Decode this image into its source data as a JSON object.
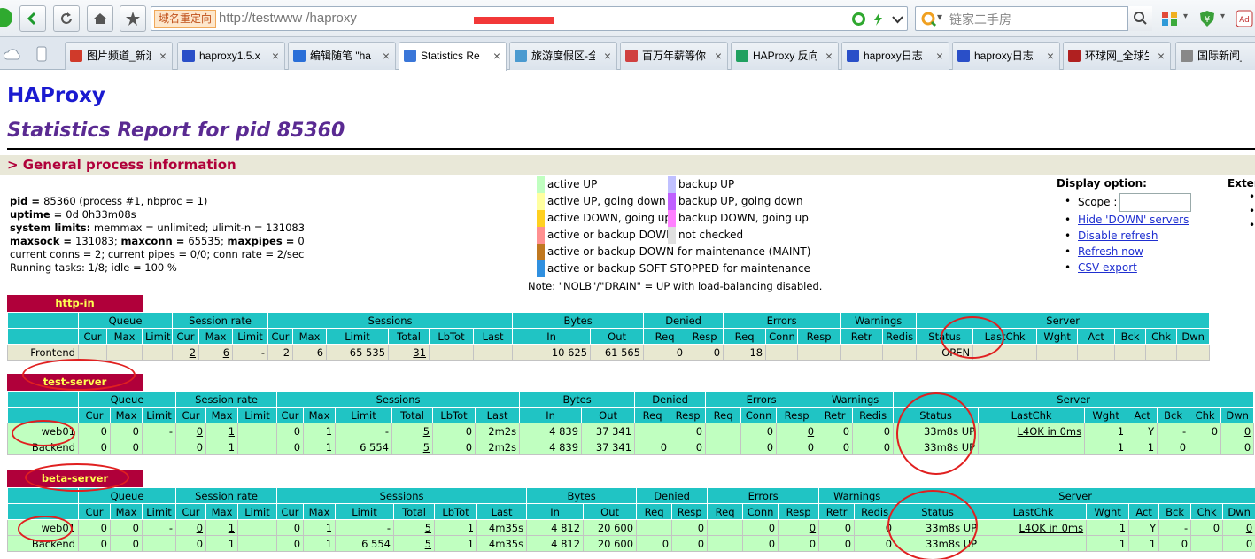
{
  "browser": {
    "redirect_label": "域名重定向",
    "url": "http://testwww                    /haproxy",
    "search_placeholder": "链家二手房"
  },
  "tabs": [
    {
      "label": "图片频道_新浪",
      "icon": "sina-icon",
      "color": "#d03a2a"
    },
    {
      "label": "haproxy1.5.x",
      "icon": "baidu-paw-icon",
      "color": "#2a4fc8"
    },
    {
      "label": "编辑随笔 \"ha",
      "icon": "blog-icon",
      "color": "#2a6fd8"
    },
    {
      "label": "Statistics Re",
      "icon": "haproxy-icon",
      "color": "#3a76d8",
      "active": true
    },
    {
      "label": "旅游度假区-全",
      "icon": "travel-icon",
      "color": "#4a9ad0"
    },
    {
      "label": "百万年薪等你",
      "icon": "job-icon",
      "color": "#d04040"
    },
    {
      "label": "HAProxy 反向",
      "icon": "csdn-icon",
      "color": "#20a060"
    },
    {
      "label": "haproxy日志",
      "icon": "baidu-paw-icon",
      "color": "#2a4fc8"
    },
    {
      "label": "haproxy日志",
      "icon": "baidu-paw-icon",
      "color": "#2a4fc8"
    },
    {
      "label": "环球网_全球生",
      "icon": "huanqiu-icon",
      "color": "#b02020"
    },
    {
      "label": "国际新闻_环",
      "icon": "page-icon",
      "color": "#888888"
    }
  ],
  "page": {
    "title": "HAProxy",
    "subtitle": "Statistics Report for pid 85360",
    "section": "> General process information",
    "info": {
      "pid_k": "pid = ",
      "pid_v": "85360 (process #1, nbproc = 1)",
      "uptime_k": "uptime = ",
      "uptime_v": "0d 0h33m08s",
      "limits_k": "system limits:",
      "limits_v": " memmax = unlimited; ulimit-n = 131083",
      "maxsock_k": "maxsock = ",
      "maxsock_v": "131083; ",
      "maxconn_k": "maxconn = ",
      "maxconn_v": "65535; ",
      "maxpipes_k": "maxpipes = ",
      "maxpipes_v": "0",
      "line5": "current conns = 2; current pipes = 0/0; conn rate = 2/sec",
      "line6": "Running tasks: 1/8; idle = 100 %"
    },
    "legend_left": [
      {
        "label": "active UP",
        "color": "#c0ffc0"
      },
      {
        "label": "active UP, going down",
        "color": "#ffffa0"
      },
      {
        "label": "active DOWN, going up",
        "color": "#ffd020"
      },
      {
        "label": "active or backup DOWN",
        "color": "#ff9090"
      },
      {
        "label": "active or backup DOWN for maintenance (MAINT)",
        "color": "#c07820"
      },
      {
        "label": "active or backup SOFT STOPPED for maintenance",
        "color": "#3090e0"
      }
    ],
    "legend_right": [
      {
        "label": "backup UP",
        "color": "#c0c0ff"
      },
      {
        "label": "backup UP, going down",
        "color": "#c060ff"
      },
      {
        "label": "backup DOWN, going up",
        "color": "#ff80ff"
      },
      {
        "label": "not checked",
        "color": "#e0e0e0"
      }
    ],
    "note": "Note: \"NOLB\"/\"DRAIN\" = UP with load-balancing disabled.",
    "display": {
      "title": "Display option:",
      "scope": "Scope :",
      "hide_down": "Hide 'DOWN' servers",
      "disable_refresh": "Disable refresh",
      "refresh_now": "Refresh now",
      "csv": "CSV export"
    },
    "external": "Exter"
  },
  "headers": {
    "groups": [
      "Queue",
      "Session rate",
      "Sessions",
      "Bytes",
      "Denied",
      "Errors",
      "Warnings",
      "Server"
    ],
    "cols": [
      "Cur",
      "Max",
      "Limit",
      "Cur",
      "Max",
      "Limit",
      "Cur",
      "Max",
      "Limit",
      "Total",
      "LbTot",
      "Last",
      "In",
      "Out",
      "Req",
      "Resp",
      "Req",
      "Conn",
      "Resp",
      "Retr",
      "Redis",
      "Status",
      "LastChk",
      "Wght",
      "Act",
      "Bck",
      "Chk",
      "Dwn"
    ]
  },
  "proxies": [
    {
      "name": "http-in",
      "rows": [
        [
          "Frontend",
          "",
          "",
          "",
          "2",
          "6",
          "-",
          "2",
          "6",
          "65 535",
          "31",
          "",
          "",
          "10 625",
          "61 565",
          "0",
          "0",
          "18",
          "",
          "",
          "",
          "",
          "OPEN",
          "",
          "",
          "",
          "",
          "",
          ""
        ]
      ]
    },
    {
      "name": "test-server",
      "rows": [
        [
          "web01",
          "0",
          "0",
          "-",
          "0",
          "1",
          "",
          "0",
          "1",
          "-",
          "5",
          "0",
          "2m2s",
          "4 839",
          "37 341",
          "",
          "0",
          "",
          "0",
          "0",
          "0",
          "0",
          "33m8s UP",
          "L4OK in 0ms",
          "1",
          "Y",
          "-",
          "0",
          "0"
        ],
        [
          "Backend",
          "0",
          "0",
          "",
          "0",
          "1",
          "",
          "0",
          "1",
          "6 554",
          "5",
          "0",
          "2m2s",
          "4 839",
          "37 341",
          "0",
          "0",
          "",
          "0",
          "0",
          "0",
          "0",
          "33m8s UP",
          "",
          "1",
          "1",
          "0",
          "",
          "0"
        ]
      ]
    },
    {
      "name": "beta-server",
      "rows": [
        [
          "web01",
          "0",
          "0",
          "-",
          "0",
          "1",
          "",
          "0",
          "1",
          "-",
          "5",
          "1",
          "4m35s",
          "4 812",
          "20 600",
          "",
          "0",
          "",
          "0",
          "0",
          "0",
          "0",
          "33m8s UP",
          "L4OK in 0ms",
          "1",
          "Y",
          "-",
          "0",
          "0"
        ],
        [
          "Backend",
          "0",
          "0",
          "",
          "0",
          "1",
          "",
          "0",
          "1",
          "6 554",
          "5",
          "1",
          "4m35s",
          "4 812",
          "20 600",
          "0",
          "0",
          "",
          "0",
          "0",
          "0",
          "0",
          "33m8s UP",
          "",
          "1",
          "1",
          "0",
          "",
          "0"
        ]
      ]
    }
  ]
}
